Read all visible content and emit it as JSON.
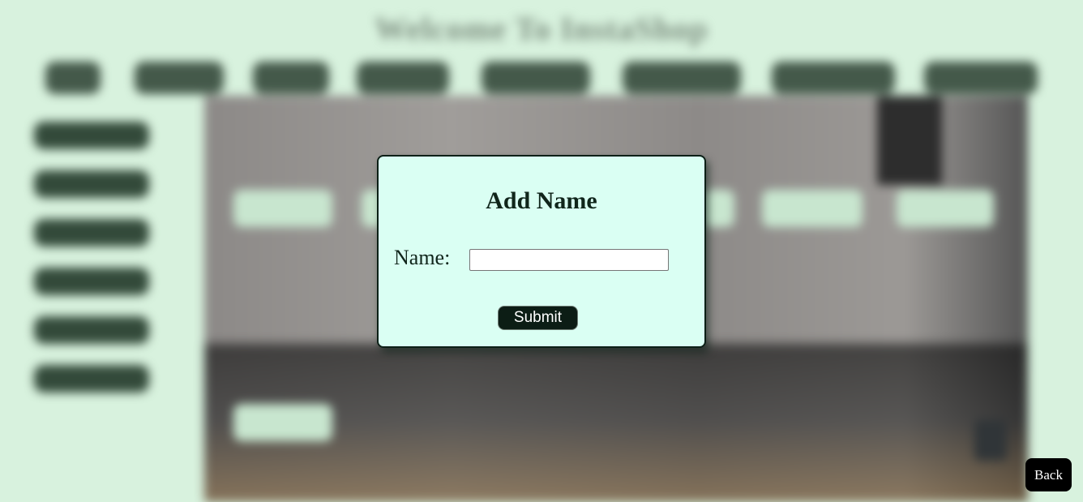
{
  "background": {
    "title": "Welcome To InstaShop"
  },
  "modal": {
    "title": "Add Name",
    "name_label": "Name:",
    "name_value": "",
    "submit_label": "Submit"
  },
  "back_label": "Back",
  "colors": {
    "page_bg": "#d8f2de",
    "modal_bg": "#dafff3",
    "dark_green": "#0c1d15",
    "button_black": "#000000"
  }
}
